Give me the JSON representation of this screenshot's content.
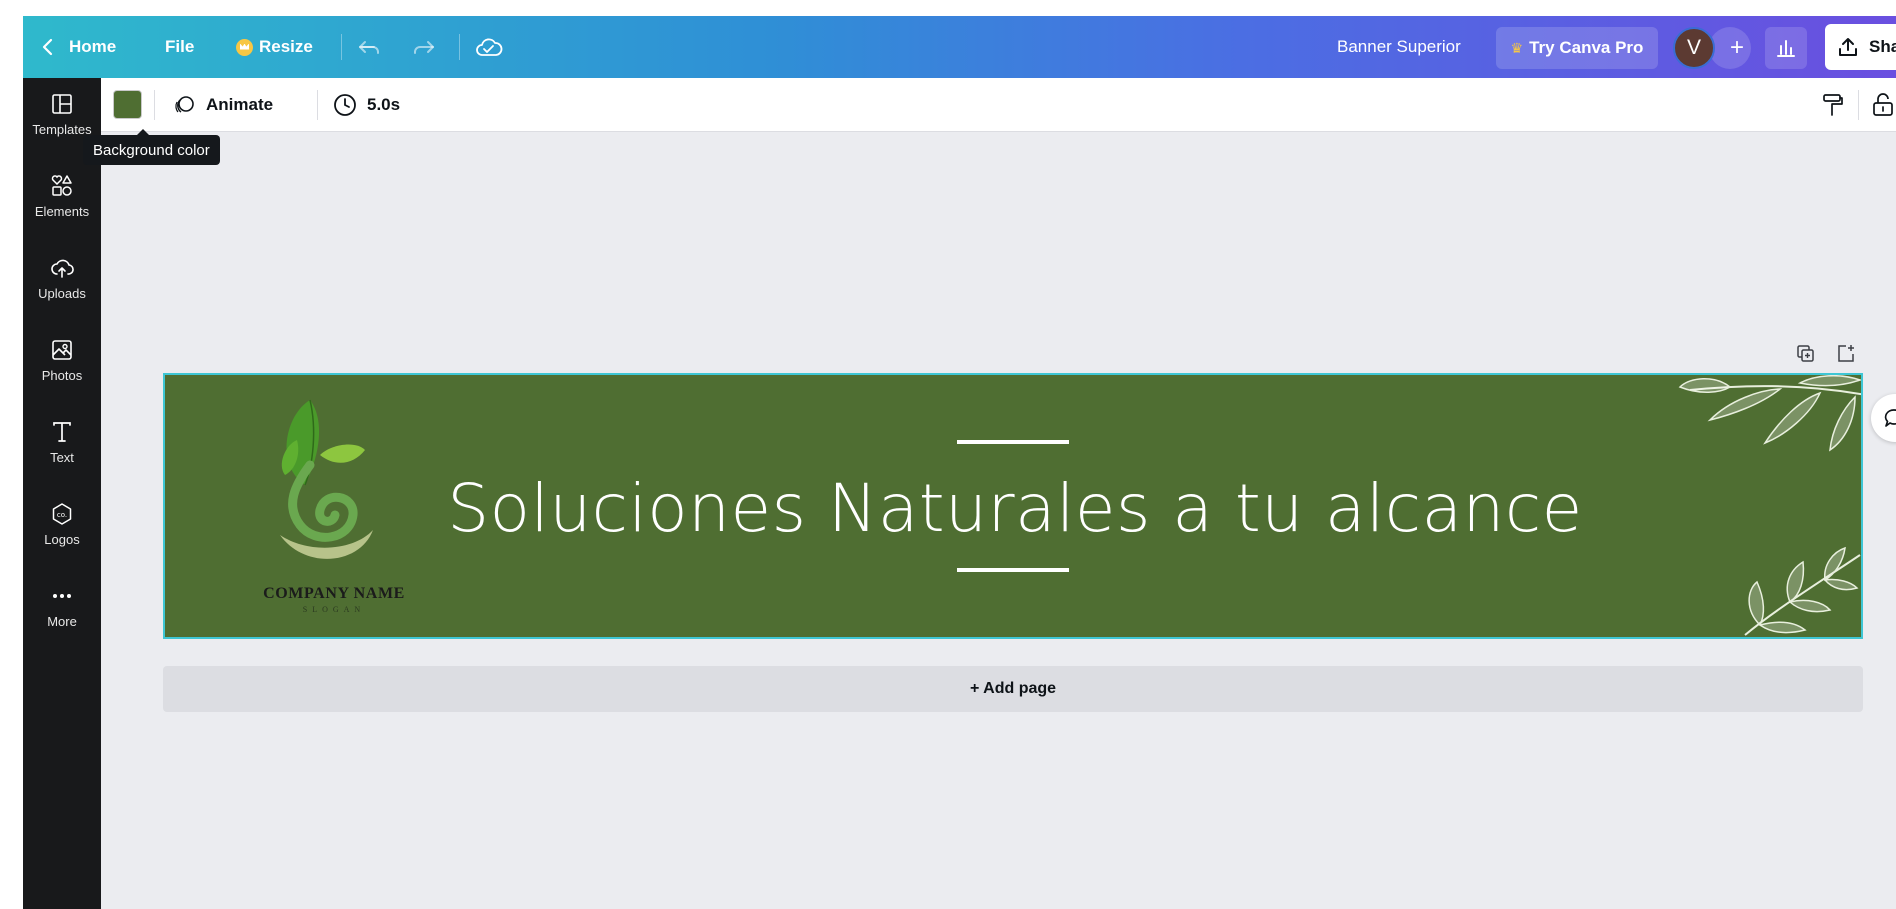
{
  "topbar": {
    "home_label": "Home",
    "file_label": "File",
    "resize_label": "Resize",
    "design_title": "Banner Superior",
    "try_pro_label": "Try Canva Pro",
    "avatar_initial": "V",
    "share_label": "Share"
  },
  "toolbar": {
    "background_color": "#4f6e32",
    "animate_label": "Animate",
    "duration": "5.0s"
  },
  "tooltip": {
    "text": "Background color"
  },
  "sidebar": {
    "items": [
      {
        "label": "Templates",
        "icon": "templates-icon"
      },
      {
        "label": "Elements",
        "icon": "elements-icon"
      },
      {
        "label": "Uploads",
        "icon": "uploads-icon"
      },
      {
        "label": "Photos",
        "icon": "photos-icon"
      },
      {
        "label": "Text",
        "icon": "text-icon"
      },
      {
        "label": "Logos",
        "icon": "logos-icon"
      },
      {
        "label": "More",
        "icon": "more-icon"
      }
    ]
  },
  "banner": {
    "title": "Soluciones Naturales a tu alcance",
    "logo_text": "COMPANY NAME",
    "logo_subtext": "SLOGAN",
    "background": "#4f6e32",
    "selection_border": "#3ec6d4"
  },
  "canvas": {
    "add_page_label": "+ Add page"
  },
  "colors": {
    "topbar_gradient_start": "#2fb9cc",
    "topbar_gradient_end": "#6a4fe0",
    "sidebar_bg": "#18191b",
    "canvas_bg": "#ebecf0"
  }
}
